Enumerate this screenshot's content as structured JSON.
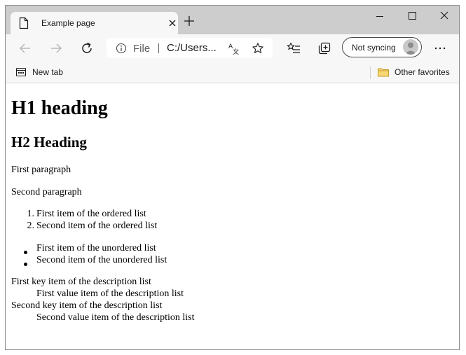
{
  "browser": {
    "tab_title": "Example page",
    "address": {
      "scheme_label": "File",
      "url": "C:/Users..."
    },
    "sync_label": "Not syncing",
    "bookmarks": {
      "new_tab": "New tab",
      "other_favorites": "Other favorites"
    }
  },
  "content": {
    "h1": "H1 heading",
    "h2": "H2 Heading",
    "paragraphs": [
      "First paragraph",
      "Second paragraph"
    ],
    "ordered_list": [
      {
        "number": "1.",
        "text": "First item of the ordered list"
      },
      {
        "number": "2.",
        "text": "Second item of the ordered list"
      }
    ],
    "unordered_list": [
      "First item of the unordered list",
      "Second item of the unordered list"
    ],
    "description_list": [
      {
        "term": "First key item of the description list",
        "value": "First value item of the description list"
      },
      {
        "term": "Second key item of the description list",
        "value": "Second value item of the description list"
      }
    ]
  }
}
